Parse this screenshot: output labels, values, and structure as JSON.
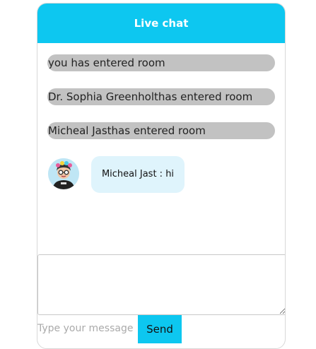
{
  "header": {
    "title": "Live chat"
  },
  "system_messages": [
    {
      "text": "you has entered room"
    },
    {
      "text": "Dr. Sophia Greenholthas entered room"
    },
    {
      "text": "Micheal Jasthas entered room"
    }
  ],
  "chat_messages": [
    {
      "text": "Micheal Jast : hi",
      "avatar_icon": "user-avatar-icon"
    }
  ],
  "composer": {
    "textarea_value": "",
    "input_placeholder": "Type your message",
    "send_label": "Send"
  },
  "colors": {
    "accent": "#0dc7f0",
    "system_bubble": "#c2c2c2",
    "chat_bubble": "#dff4fc"
  }
}
